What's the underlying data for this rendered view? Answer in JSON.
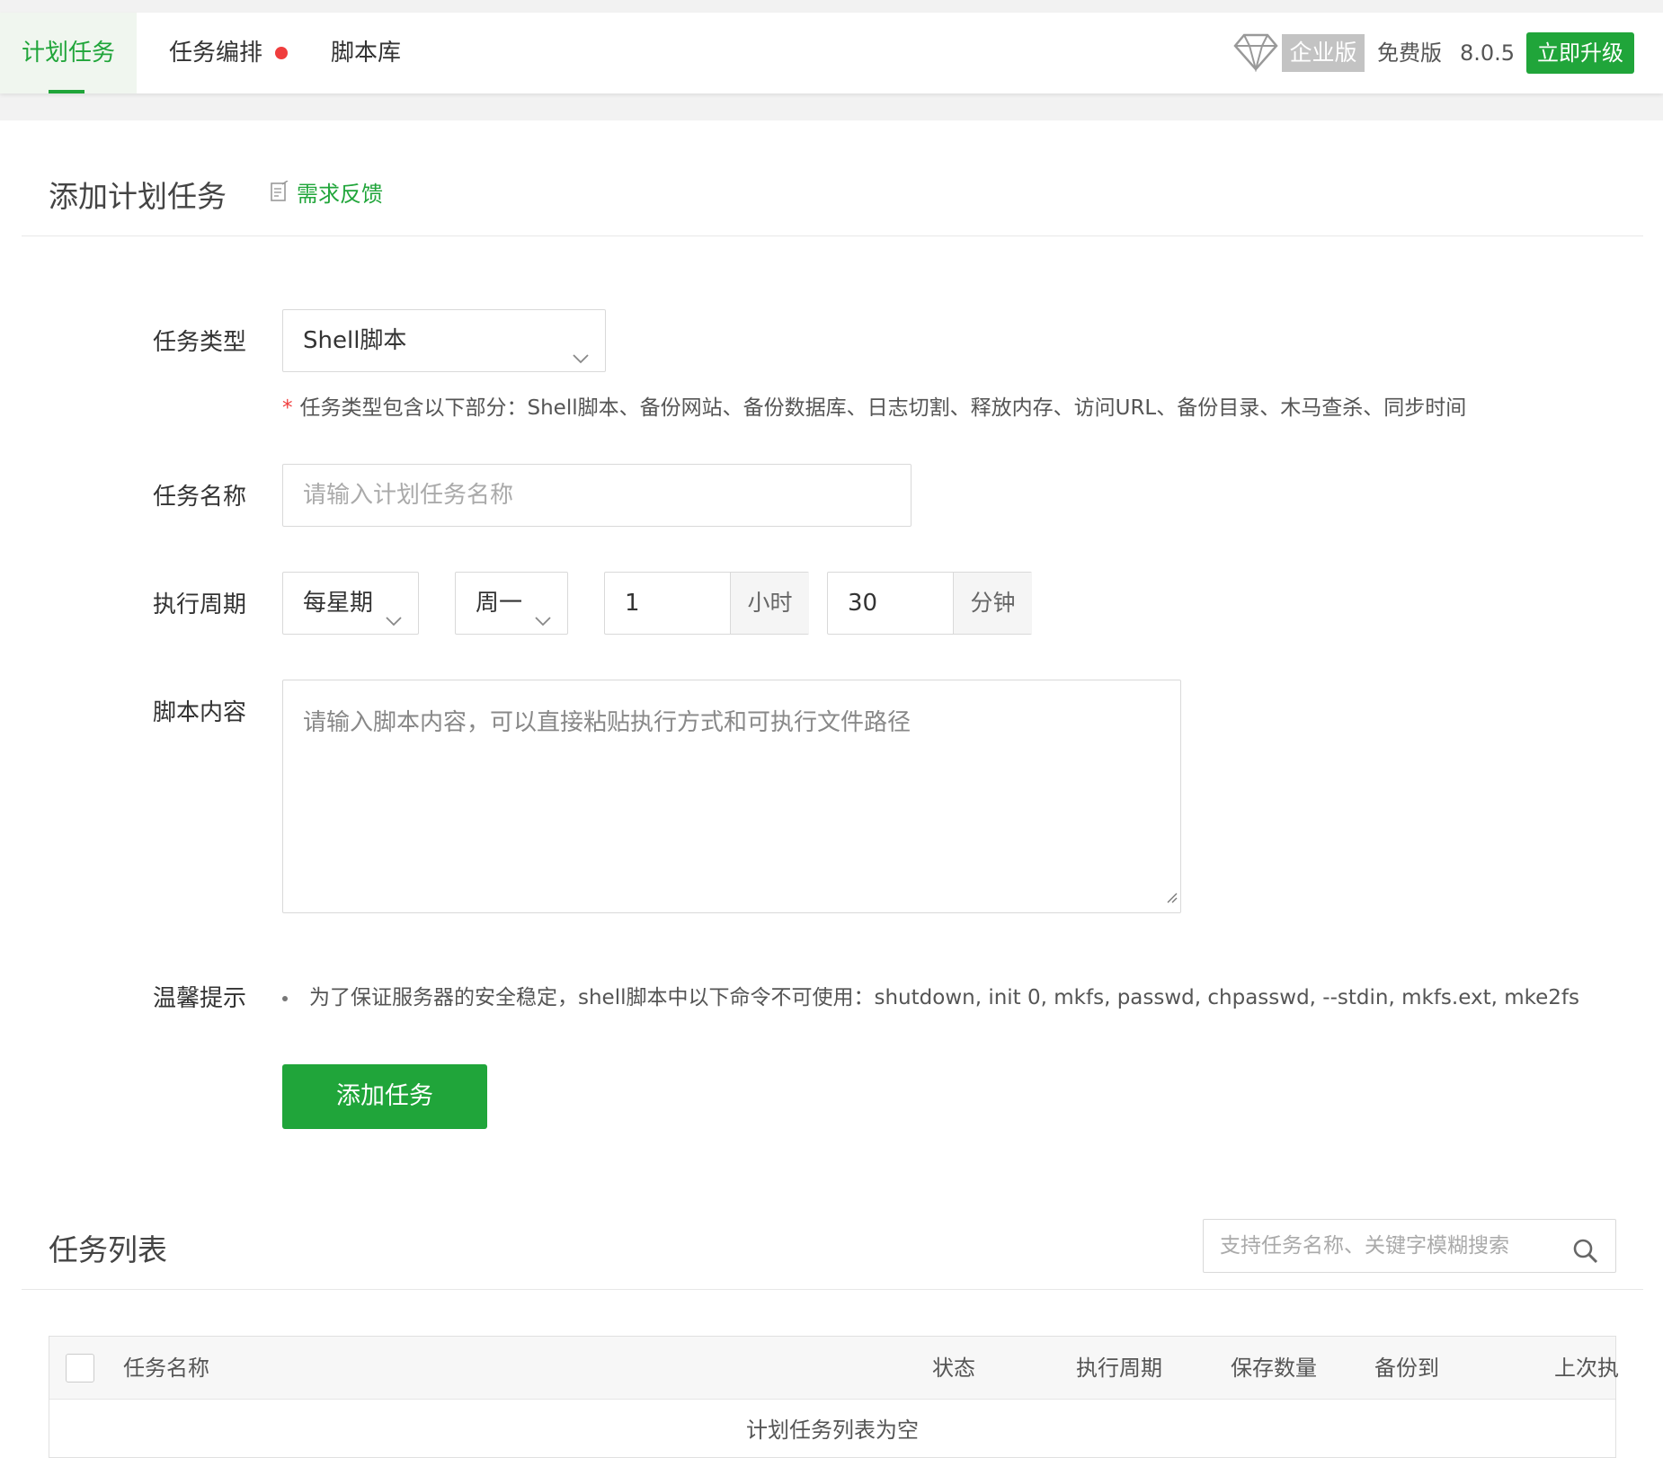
{
  "nav": {
    "tabs": [
      {
        "label": "计划任务",
        "active": true
      },
      {
        "label": "任务编排",
        "has_dot": true
      },
      {
        "label": "脚本库"
      }
    ],
    "enterprise_label": "企业版",
    "free_label": "免费版",
    "version": "8.0.5",
    "upgrade_label": "立即升级"
  },
  "add_section": {
    "title": "添加计划任务",
    "feedback_label": "需求反馈"
  },
  "form": {
    "task_type": {
      "label": "任务类型",
      "value": "Shell脚本",
      "hint_star": "*",
      "hint": "任务类型包含以下部分：Shell脚本、备份网站、备份数据库、日志切割、释放内存、访问URL、备份目录、木马查杀、同步时间"
    },
    "task_name": {
      "label": "任务名称",
      "placeholder": "请输入计划任务名称"
    },
    "cycle": {
      "label": "执行周期",
      "period": "每星期",
      "weekday": "周一",
      "hour": "1",
      "hour_unit": "小时",
      "minute": "30",
      "minute_unit": "分钟"
    },
    "script": {
      "label": "脚本内容",
      "placeholder": "请输入脚本内容，可以直接粘贴执行方式和可执行文件路径"
    },
    "tip": {
      "label": "温馨提示",
      "text": "为了保证服务器的安全稳定，shell脚本中以下命令不可使用：shutdown, init 0, mkfs, passwd, chpasswd, --stdin, mkfs.ext, mke2fs"
    },
    "submit_label": "添加任务"
  },
  "list_section": {
    "title": "任务列表",
    "search_placeholder": "支持任务名称、关键字模糊搜索",
    "columns": [
      "任务名称",
      "状态",
      "执行周期",
      "保存数量",
      "备份到",
      "上次执"
    ],
    "empty_text": "计划任务列表为空"
  },
  "colors": {
    "accent": "#20a53a",
    "dot": "#f03d3d",
    "badge_gray": "#c3c3c3"
  }
}
